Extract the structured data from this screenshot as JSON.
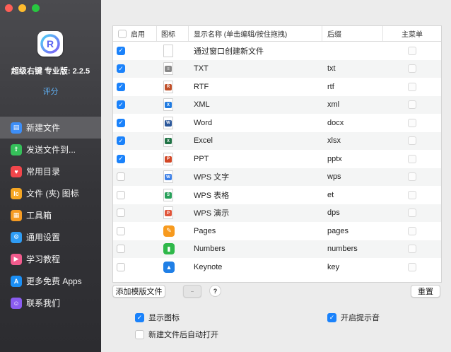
{
  "sidebar": {
    "app_name": "超级右键 专业版: 2.2.5",
    "rate_label": "评分",
    "items": [
      {
        "label": "新建文件",
        "icon": "new-file-icon",
        "color": "#3d8ef7",
        "glyph": "▤",
        "active": true
      },
      {
        "label": "发送文件到...",
        "icon": "send-file-icon",
        "color": "#35c05a",
        "glyph": "⇪",
        "active": false
      },
      {
        "label": "常用目录",
        "icon": "heart-icon",
        "color": "#f1464b",
        "glyph": "♥",
        "active": false
      },
      {
        "label": "文件 (夹) 图标",
        "icon": "icon-badge-icon",
        "color": "#f5a623",
        "glyph": "Ic",
        "active": false
      },
      {
        "label": "工具箱",
        "icon": "toolbox-icon",
        "color": "#f59b23",
        "glyph": "▦",
        "active": false
      },
      {
        "label": "通用设置",
        "icon": "gear-icon",
        "color": "#2f9cf4",
        "glyph": "⚙",
        "active": false
      },
      {
        "label": "学习教程",
        "icon": "tutorial-icon",
        "color": "#f25b8d",
        "glyph": "▶",
        "active": false
      },
      {
        "label": "更多免费 Apps",
        "icon": "app-store-icon",
        "color": "#1b8ff5",
        "glyph": "A",
        "active": false
      },
      {
        "label": "联系我们",
        "icon": "contact-icon",
        "color": "#8a5cf0",
        "glyph": "☺",
        "active": false
      }
    ]
  },
  "table": {
    "headers": {
      "enabled": "启用",
      "icon": "图标",
      "name": "显示名称 (单击编辑/按住拖拽)",
      "suffix": "后缀",
      "main_menu": "主菜单"
    },
    "rows": [
      {
        "enabled": true,
        "icon": "blank-file-icon",
        "name": "通过窗口创建新文件",
        "suffix": ""
      },
      {
        "enabled": true,
        "icon": "txt-file-icon",
        "name": "TXT",
        "suffix": "txt"
      },
      {
        "enabled": true,
        "icon": "rtf-file-icon",
        "name": "RTF",
        "suffix": "rtf"
      },
      {
        "enabled": true,
        "icon": "xml-file-icon",
        "name": "XML",
        "suffix": "xml"
      },
      {
        "enabled": true,
        "icon": "word-icon",
        "name": "Word",
        "suffix": "docx"
      },
      {
        "enabled": true,
        "icon": "excel-icon",
        "name": "Excel",
        "suffix": "xlsx"
      },
      {
        "enabled": true,
        "icon": "powerpoint-icon",
        "name": "PPT",
        "suffix": "pptx"
      },
      {
        "enabled": false,
        "icon": "wps-writer-icon",
        "name": "WPS 文字",
        "suffix": "wps"
      },
      {
        "enabled": false,
        "icon": "wps-sheet-icon",
        "name": "WPS 表格",
        "suffix": "et"
      },
      {
        "enabled": false,
        "icon": "wps-slides-icon",
        "name": "WPS 演示",
        "suffix": "dps"
      },
      {
        "enabled": false,
        "icon": "pages-icon",
        "name": "Pages",
        "suffix": "pages"
      },
      {
        "enabled": false,
        "icon": "numbers-icon",
        "name": "Numbers",
        "suffix": "numbers"
      },
      {
        "enabled": false,
        "icon": "keynote-icon",
        "name": "Keynote",
        "suffix": "key"
      }
    ]
  },
  "toolbar": {
    "add_template_label": "添加模版文件",
    "remove_label": "−",
    "help_label": "?",
    "reset_label": "重置"
  },
  "options": {
    "show_icon_label": "显示图标",
    "show_icon_checked": true,
    "sound_label": "开启提示音",
    "sound_checked": true,
    "auto_open_label": "新建文件后自动打开",
    "auto_open_checked": false
  },
  "colors": {
    "accent": "#1a82fb",
    "rate_link": "#5fb0f5",
    "sidebar_bg": "#343438"
  }
}
